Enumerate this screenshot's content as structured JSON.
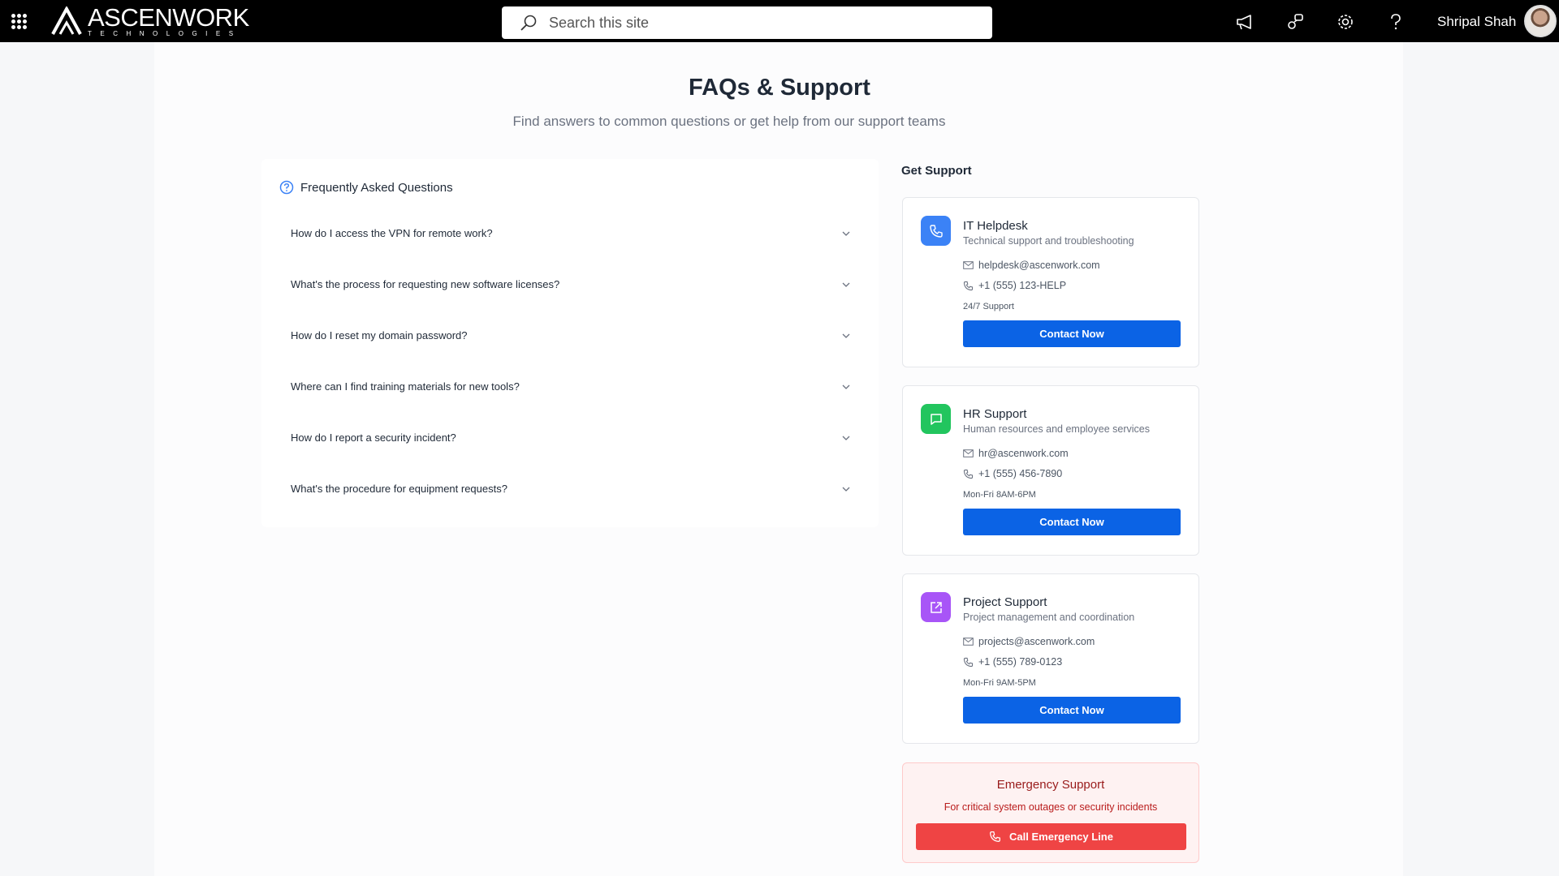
{
  "header": {
    "logo_name": "ASCENWORK",
    "logo_sub": "TECHNOLOGIES",
    "search_placeholder": "Search this site",
    "user_name": "Shripal Shah",
    "icons": [
      "waffle-icon",
      "megaphone-icon",
      "share-icon",
      "gear-icon",
      "help-icon"
    ]
  },
  "page": {
    "title": "FAQs & Support",
    "subtitle": "Find answers to common questions or get help from our support teams"
  },
  "faq": {
    "heading": "Frequently Asked Questions",
    "items": [
      {
        "question": "How do I access the VPN for remote work?"
      },
      {
        "question": "What's the process for requesting new software licenses?"
      },
      {
        "question": "How do I reset my domain password?"
      },
      {
        "question": "Where can I find training materials for new tools?"
      },
      {
        "question": "How do I report a security incident?"
      },
      {
        "question": "What's the procedure for equipment requests?"
      }
    ]
  },
  "support": {
    "heading": "Get Support",
    "cards": [
      {
        "title": "IT Helpdesk",
        "desc": "Technical support and troubleshooting",
        "email": "helpdesk@ascenwork.com",
        "phone": "+1 (555) 123-HELP",
        "hours": "24/7 Support",
        "button": "Contact Now",
        "icon": "phone-icon",
        "color": "#3b82f6"
      },
      {
        "title": "HR Support",
        "desc": "Human resources and employee services",
        "email": "hr@ascenwork.com",
        "phone": "+1 (555) 456-7890",
        "hours": "Mon-Fri 8AM-6PM",
        "button": "Contact Now",
        "icon": "chat-icon",
        "color": "#22c55e"
      },
      {
        "title": "Project Support",
        "desc": "Project management and coordination",
        "email": "projects@ascenwork.com",
        "phone": "+1 (555) 789-0123",
        "hours": "Mon-Fri 9AM-5PM",
        "button": "Contact Now",
        "icon": "external-link-icon",
        "color": "#a855f7"
      }
    ],
    "emergency": {
      "title": "Emergency Support",
      "desc": "For critical system outages or security incidents",
      "button": "Call Emergency Line"
    }
  },
  "colors": {
    "accent": "#0b63e5",
    "emergency": "#ef4444",
    "topbar": "#000000"
  }
}
